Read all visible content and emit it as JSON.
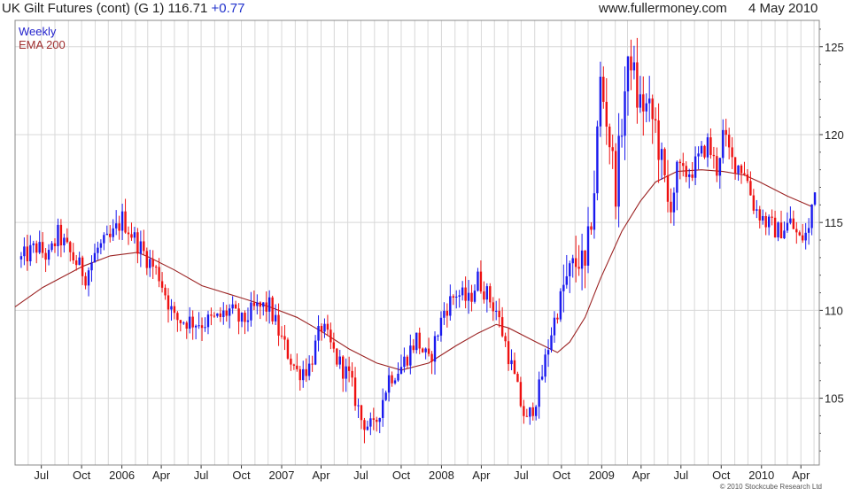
{
  "header": {
    "title": "UK Gilt Futures (cont) (G 1) 116.71",
    "change": "+0.77",
    "site": "www.fullermoney.com",
    "date": "4 May 2010"
  },
  "footer": {
    "copyright": "© 2010 Stockcube Research Ltd"
  },
  "chart_data": {
    "type": "candlestick",
    "title": "UK Gilt Futures (cont) (G 1)",
    "y_axis_side": "right",
    "ylim": [
      101.2,
      126.5
    ],
    "yticks": [
      105,
      110,
      115,
      120,
      125
    ],
    "x_tick_labels": [
      "Jul",
      "Oct",
      "2006",
      "Apr",
      "Jul",
      "Oct",
      "2007",
      "Apr",
      "Jul",
      "Oct",
      "2008",
      "Apr",
      "Jul",
      "Oct",
      "2009",
      "Apr",
      "Jul",
      "Oct",
      "2010",
      "Apr"
    ],
    "grid": true,
    "legend": [
      "Weekly",
      "EMA 200"
    ],
    "colors": {
      "up": "#1a1aee",
      "down": "#ee1111",
      "ema": "#9b2222",
      "grid": "#d8d8d8",
      "frame": "#888888"
    },
    "series": [
      {
        "name": "Weekly",
        "style": "candlestick",
        "frequency": "weekly",
        "anchors": [
          [
            "2005-05-16",
            112.9
          ],
          [
            "2005-06-20",
            113.6
          ],
          [
            "2005-07-18",
            113.0
          ],
          [
            "2005-08-08",
            114.3
          ],
          [
            "2005-09-05",
            113.2
          ],
          [
            "2005-10-10",
            112.0
          ],
          [
            "2005-11-07",
            113.5
          ],
          [
            "2005-12-05",
            114.0
          ],
          [
            "2006-01-02",
            115.2
          ],
          [
            "2006-02-01",
            114.0
          ],
          [
            "2006-02-27",
            113.0
          ],
          [
            "2006-03-27",
            112.0
          ],
          [
            "2006-05-01",
            109.5
          ],
          [
            "2006-06-01",
            109.4
          ],
          [
            "2006-07-03",
            109.3
          ],
          [
            "2006-08-07",
            109.5
          ],
          [
            "2006-09-04",
            110.0
          ],
          [
            "2006-10-02",
            109.3
          ],
          [
            "2006-11-01",
            110.1
          ],
          [
            "2006-12-04",
            110.2
          ],
          [
            "2007-01-01",
            108.3
          ],
          [
            "2007-02-05",
            106.5
          ],
          [
            "2007-03-05",
            106.8
          ],
          [
            "2007-04-02",
            109.1
          ],
          [
            "2007-05-07",
            107.2
          ],
          [
            "2007-06-04",
            106.2
          ],
          [
            "2007-07-02",
            103.8
          ],
          [
            "2007-07-30",
            103.2
          ],
          [
            "2007-09-03",
            106.2
          ],
          [
            "2007-10-01",
            106.8
          ],
          [
            "2007-11-05",
            108.4
          ],
          [
            "2007-12-03",
            107.0
          ],
          [
            "2008-01-07",
            110.0
          ],
          [
            "2008-02-04",
            111.0
          ],
          [
            "2008-03-03",
            110.5
          ],
          [
            "2008-03-24",
            111.8
          ],
          [
            "2008-05-05",
            110.0
          ],
          [
            "2008-06-02",
            107.5
          ],
          [
            "2008-07-01",
            104.6
          ],
          [
            "2008-07-14",
            103.6
          ],
          [
            "2008-08-11",
            105.5
          ],
          [
            "2008-09-08",
            108.8
          ],
          [
            "2008-10-06",
            111.3
          ],
          [
            "2008-11-10",
            113.0
          ],
          [
            "2008-11-24",
            112.0
          ],
          [
            "2008-12-15",
            117.0
          ],
          [
            "2008-12-29",
            123.0
          ],
          [
            "2009-01-12",
            121.0
          ],
          [
            "2009-02-02",
            117.0
          ],
          [
            "2009-02-23",
            122.5
          ],
          [
            "2009-03-09",
            124.5
          ],
          [
            "2009-03-23",
            122.0
          ],
          [
            "2009-04-13",
            121.5
          ],
          [
            "2009-05-04",
            120.5
          ],
          [
            "2009-06-01",
            116.0
          ],
          [
            "2009-06-22",
            117.5
          ],
          [
            "2009-07-27",
            118.0
          ],
          [
            "2009-08-31",
            119.5
          ],
          [
            "2009-09-21",
            118.0
          ],
          [
            "2009-10-05",
            120.0
          ],
          [
            "2009-10-26",
            118.5
          ],
          [
            "2009-11-23",
            118.0
          ],
          [
            "2009-12-14",
            116.0
          ],
          [
            "2010-01-11",
            115.0
          ],
          [
            "2010-02-08",
            114.5
          ],
          [
            "2010-03-08",
            115.0
          ],
          [
            "2010-03-29",
            114.0
          ],
          [
            "2010-04-19",
            114.5
          ],
          [
            "2010-04-26",
            116.0
          ],
          [
            "2010-05-03",
            116.71
          ]
        ]
      },
      {
        "name": "EMA 200",
        "style": "line",
        "points": [
          [
            "2005-05-02",
            110.2
          ],
          [
            "2005-07-04",
            111.3
          ],
          [
            "2005-10-03",
            112.5
          ],
          [
            "2005-12-05",
            113.1
          ],
          [
            "2006-02-06",
            113.3
          ],
          [
            "2006-03-06",
            113.0
          ],
          [
            "2006-05-01",
            112.3
          ],
          [
            "2006-07-03",
            111.4
          ],
          [
            "2006-10-02",
            110.7
          ],
          [
            "2006-12-04",
            110.2
          ],
          [
            "2007-02-05",
            109.6
          ],
          [
            "2007-04-02",
            108.8
          ],
          [
            "2007-06-04",
            107.8
          ],
          [
            "2007-08-06",
            107.0
          ],
          [
            "2007-10-01",
            106.6
          ],
          [
            "2007-12-03",
            107.0
          ],
          [
            "2008-02-04",
            108.0
          ],
          [
            "2008-03-24",
            108.7
          ],
          [
            "2008-05-05",
            109.2
          ],
          [
            "2008-06-02",
            109.0
          ],
          [
            "2008-08-04",
            108.2
          ],
          [
            "2008-09-22",
            107.6
          ],
          [
            "2008-10-20",
            108.2
          ],
          [
            "2008-11-24",
            109.6
          ],
          [
            "2008-12-29",
            111.8
          ],
          [
            "2009-02-16",
            114.5
          ],
          [
            "2009-03-30",
            116.2
          ],
          [
            "2009-05-04",
            117.3
          ],
          [
            "2009-06-22",
            117.9
          ],
          [
            "2009-08-17",
            118.0
          ],
          [
            "2009-10-05",
            117.9
          ],
          [
            "2009-11-23",
            117.7
          ],
          [
            "2009-12-28",
            117.3
          ],
          [
            "2010-03-01",
            116.5
          ],
          [
            "2010-04-26",
            115.9
          ]
        ]
      }
    ]
  }
}
